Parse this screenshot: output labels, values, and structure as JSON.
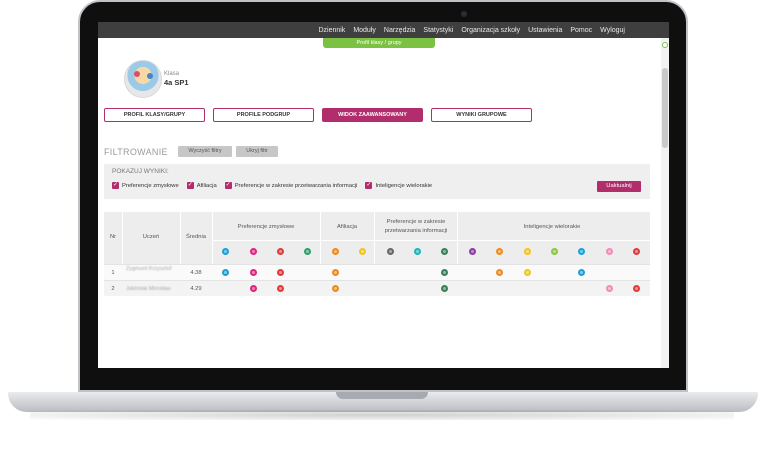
{
  "nav": {
    "items": [
      "Dziennik",
      "Moduły",
      "Narzędzia",
      "Statystyki",
      "Organizacja szkoły",
      "Ustawienia",
      "Pomoc",
      "Wyloguj"
    ]
  },
  "profile_tab": "Profil klasy / grupy",
  "class": {
    "label": "Klasa",
    "name": "4a SP1"
  },
  "tabs": [
    {
      "label": "PROFIL KLASY/GRUPY",
      "active": false
    },
    {
      "label": "PROFILE PODGRUP",
      "active": false
    },
    {
      "label": "WIDOK ZAAWANSOWANY",
      "active": true
    },
    {
      "label": "WYNIKI GRUPOWE",
      "active": false
    }
  ],
  "filter": {
    "title": "FILTROWANIE",
    "clear_label": "Wyczyść filtry",
    "hide_label": "Ukryj filtr",
    "show_results_label": "POKAZUJ WYNIKI:",
    "checkboxes": [
      {
        "label": "Preferencje zmysłowe",
        "checked": true
      },
      {
        "label": "Afiliacja",
        "checked": true
      },
      {
        "label": "Preferencje w zakresie przetwarzania informacji",
        "checked": true
      },
      {
        "label": "Inteligencje wielorakie",
        "checked": true
      }
    ],
    "update_label": "Uaktualnij"
  },
  "table": {
    "headers": {
      "nr": "Nr",
      "student": "Uczeń",
      "average": "Średnia"
    },
    "groups": [
      {
        "label": "Preferencje zmysłowe",
        "colors": [
          "#1aa0d8",
          "#e0237f",
          "#e03b3b",
          "#2e9e6e"
        ]
      },
      {
        "label": "Afiliacja",
        "colors": [
          "#f08a1c",
          "#f2c41c"
        ]
      },
      {
        "label": "Preferencje w zakresie przetwarzania informacji",
        "colors": [
          "#666666",
          "#19b6b6",
          "#3a7f5a"
        ]
      },
      {
        "label": "Inteligencje wielorakie",
        "colors": [
          "#8e3aa5",
          "#f08a1c",
          "#f2c41c",
          "#8cc63f",
          "#1aa0d8",
          "#f28cb6",
          "#e03b3b"
        ]
      }
    ],
    "rows": [
      {
        "nr": "1",
        "student": "Zygmunt Krzysztof",
        "average": "4.38",
        "dots": [
          "#1aa0d8",
          "#e0237f",
          "#e03b3b",
          "",
          "#f08a1c",
          "",
          "",
          "",
          "#3a7f5a",
          "",
          "#f08a1c",
          "#f2c41c",
          "",
          "#1aa0d8",
          "",
          ""
        ]
      },
      {
        "nr": "2",
        "student": "Jakimiak Mirosław",
        "average": "4.29",
        "dots": [
          "",
          "#e0237f",
          "#e03b3b",
          "",
          "#f08a1c",
          "",
          "",
          "",
          "#3a7f5a",
          "",
          "",
          "",
          "",
          "",
          "#f28cb6",
          "#e03b3b"
        ]
      }
    ]
  }
}
